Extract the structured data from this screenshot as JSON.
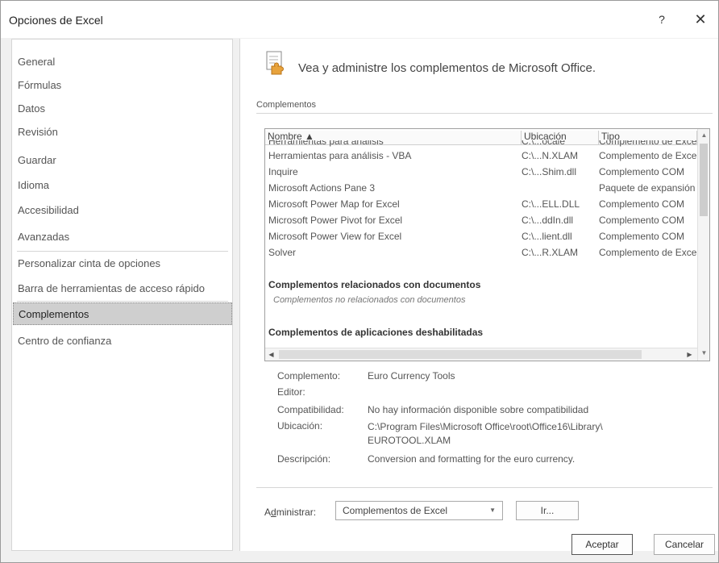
{
  "window": {
    "title": "Opciones de Excel",
    "help_glyph": "?",
    "close_glyph": "✕"
  },
  "sidebar": {
    "items": [
      {
        "label": "General"
      },
      {
        "label": "Fórmulas"
      },
      {
        "label": "Datos"
      },
      {
        "label": "Revisión"
      },
      {
        "label": "Guardar"
      },
      {
        "label": "Idioma"
      },
      {
        "label": "Accesibilidad"
      },
      {
        "label": "Avanzadas"
      },
      {
        "label": "Personalizar cinta de opciones"
      },
      {
        "label": "Barra de herramientas de acceso rápido"
      },
      {
        "label": "Complementos"
      },
      {
        "label": "Centro de confianza"
      }
    ],
    "active": "Complementos"
  },
  "main": {
    "header_text": "Vea y administre los complementos de Microsoft Office.",
    "section_title": "Complementos",
    "table": {
      "columns": [
        "Nombre ▲",
        "Ubicación",
        "Tipo"
      ],
      "partial_row": {
        "name": "Herramientas para análisis",
        "location": "C:\\...ocale",
        "type": "Complemento de Excel"
      },
      "rows": [
        {
          "name": "Herramientas para análisis - VBA",
          "location": "C:\\...N.XLAM",
          "type": "Complemento de Excel"
        },
        {
          "name": "Inquire",
          "location": "C:\\...Shim.dll",
          "type": "Complemento COM"
        },
        {
          "name": "Microsoft Actions Pane 3",
          "location": "",
          "type": "Paquete de expansión XML"
        },
        {
          "name": "Microsoft Power Map for Excel",
          "location": "C:\\...ELL.DLL",
          "type": "Complemento COM"
        },
        {
          "name": "Microsoft Power Pivot for Excel",
          "location": "C:\\...ddIn.dll",
          "type": "Complemento COM"
        },
        {
          "name": "Microsoft Power View for Excel",
          "location": "C:\\...lient.dll",
          "type": "Complemento COM"
        },
        {
          "name": "Solver",
          "location": "C:\\...R.XLAM",
          "type": "Complemento de Excel"
        }
      ],
      "groups": {
        "doc_related_title": "Complementos relacionados con documentos",
        "doc_related_empty": "Complementos no relacionados con documentos",
        "disabled_title": "Complementos de aplicaciones deshabilitadas"
      }
    },
    "details": {
      "addin_label": "Complemento:",
      "addin_value": "Euro Currency Tools",
      "publisher_label": "Editor:",
      "publisher_value": "",
      "compat_label": "Compatibilidad:",
      "compat_value": "No hay información disponible sobre compatibilidad",
      "location_label": "Ubicación:",
      "location_value": "C:\\Program Files\\Microsoft Office\\root\\Office16\\Library\\ EUROTOOL.XLAM",
      "description_label": "Descripción:",
      "description_value": "Conversion and formatting for the euro currency."
    },
    "manage": {
      "label_pre": "A",
      "label_underlined": "d",
      "label_post": "ministrar:",
      "selected": "Complementos de Excel",
      "go_label": "Ir..."
    }
  },
  "footer": {
    "ok_label": "Aceptar",
    "cancel_label": "Cancelar"
  }
}
